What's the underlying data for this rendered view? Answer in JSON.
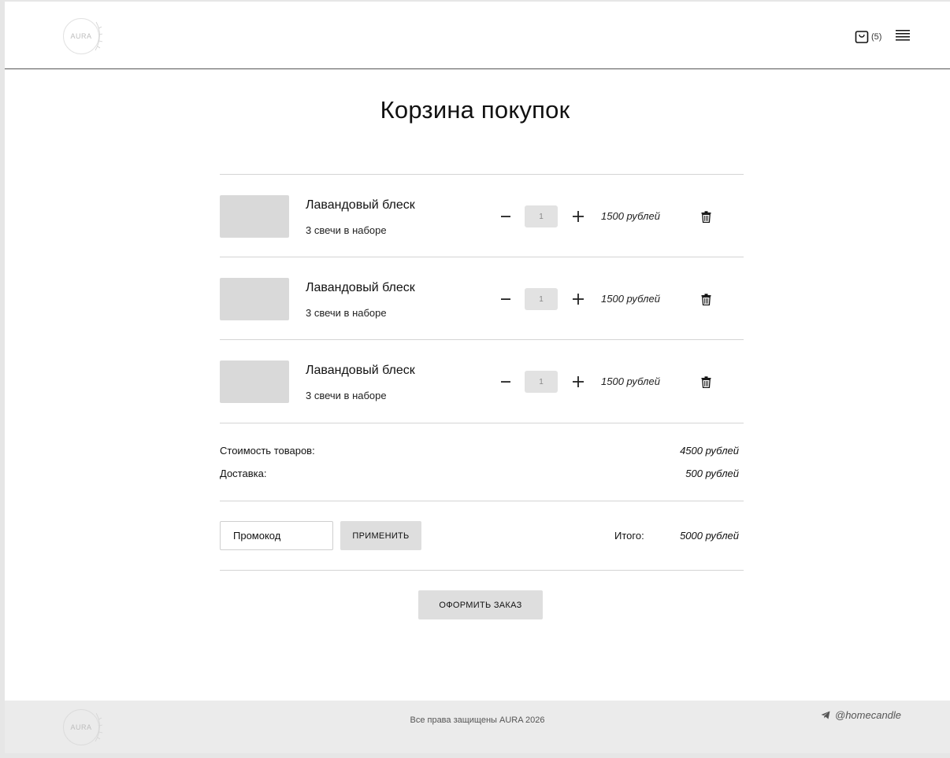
{
  "header": {
    "logo_text": "AURA",
    "cart_count": "(5)",
    "cart_icon": "shopping-bag-icon",
    "menu_icon": "hamburger-menu-icon"
  },
  "page": {
    "title": "Корзина покупок"
  },
  "cart": {
    "items": [
      {
        "title": "Лавандовый блеск",
        "subtitle": "3 свечи в наборе",
        "quantity": "1",
        "price": "1500 рублей"
      },
      {
        "title": "Лавандовый блеск",
        "subtitle": "3 свечи в наборе",
        "quantity": "1",
        "price": "1500 рублей"
      },
      {
        "title": "Лавандовый блеск",
        "subtitle": "3 свечи в наборе",
        "quantity": "1",
        "price": "1500 рублей"
      }
    ]
  },
  "summary": {
    "goods_label": "Стоимость товаров:",
    "goods_value": "4500 рублей",
    "delivery_label": "Доставка:",
    "delivery_value": "500 рублей",
    "total_label": "Итого:",
    "total_value": "5000 рублей"
  },
  "promo": {
    "placeholder": "Промокод",
    "apply_label": "ПРИМЕНИТЬ"
  },
  "checkout": {
    "order_label": "ОФОРМИТЬ ЗАКАЗ"
  },
  "footer": {
    "logo_text": "AURA",
    "copyright": "Все права защищены AURA 2026",
    "telegram_handle": "@homecandle"
  },
  "colors": {
    "placeholder_gray": "#d9d9d9",
    "button_gray": "#dedede",
    "footer_bg": "#ebebeb",
    "text": "#111111"
  }
}
